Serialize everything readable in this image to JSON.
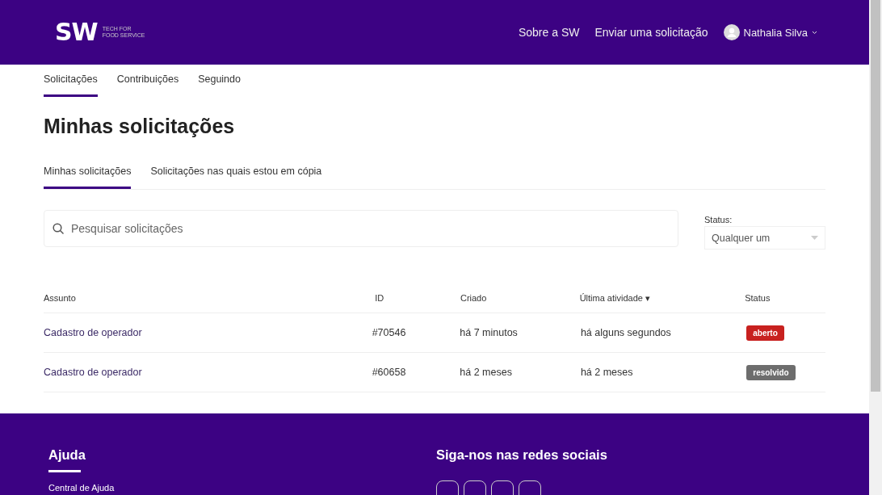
{
  "header": {
    "logo": "SW",
    "tagline": [
      "TECH FOR",
      "FOOD SERVICE"
    ],
    "links": [
      "Sobre a SW",
      "Enviar uma solicitação"
    ],
    "user": "Nathalia Silva"
  },
  "profile_tabs": [
    {
      "label": "Solicitações",
      "selected": true
    },
    {
      "label": "Contribuições",
      "selected": false
    },
    {
      "label": "Seguindo",
      "selected": false
    }
  ],
  "title": "Minhas solicitações",
  "request_tabs": [
    {
      "label": "Minhas solicitações",
      "selected": true
    },
    {
      "label": "Solicitações nas quais estou em cópia",
      "selected": false
    }
  ],
  "search": {
    "placeholder": "Pesquisar solicitações"
  },
  "status_filter": {
    "label": "Status:",
    "value": "Qualquer um"
  },
  "table": {
    "columns": [
      "Assunto",
      "ID",
      "Criado",
      "Última atividade ▾",
      "Status"
    ],
    "rows": [
      {
        "subject": "Cadastro de operador",
        "id": "#70546",
        "created": "há 7 minutos",
        "activity": "há alguns segundos",
        "status": "aberto",
        "color": "#c8211f"
      },
      {
        "subject": "Cadastro de operador",
        "id": "#60658",
        "created": "há 2 meses",
        "activity": "há 2 meses",
        "status": "resolvido",
        "color": "#6d6d6d"
      }
    ]
  },
  "footer": {
    "help": {
      "title": "Ajuda",
      "links": [
        "Central de Ajuda"
      ]
    },
    "social": {
      "title": "Siga-nos nas redes sociais"
    }
  }
}
